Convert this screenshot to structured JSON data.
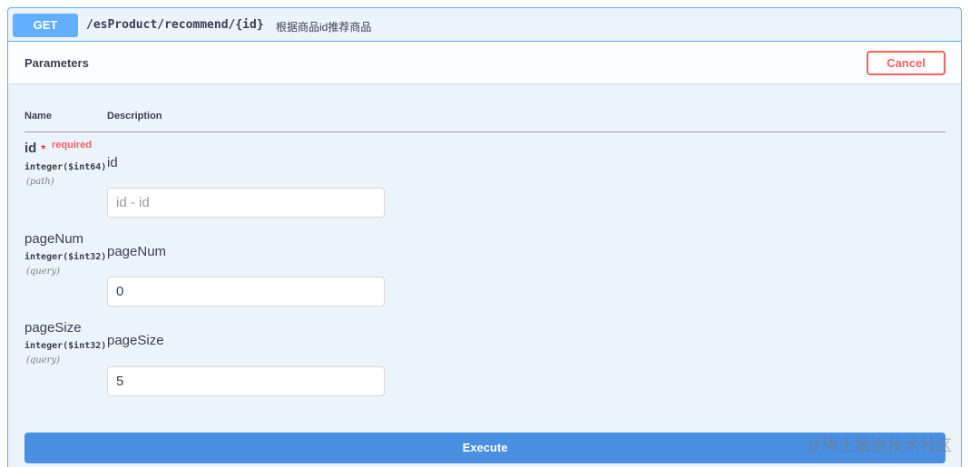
{
  "summary": {
    "method": "GET",
    "path": "/esProduct/recommend/{id}",
    "description": "根据商品id推荐商品"
  },
  "parameters": {
    "title": "Parameters",
    "cancel_label": "Cancel",
    "columns": {
      "name": "Name",
      "description": "Description"
    },
    "items": [
      {
        "name": "id",
        "required_star": "*",
        "required_label": "required",
        "type": "integer($int64)",
        "in": "(path)",
        "description": "id",
        "value": "",
        "placeholder": "id - id"
      },
      {
        "name": "pageNum",
        "type": "integer($int32)",
        "in": "(query)",
        "description": "pageNum",
        "value": "0",
        "placeholder": ""
      },
      {
        "name": "pageSize",
        "type": "integer($int32)",
        "in": "(query)",
        "description": "pageSize",
        "value": "5",
        "placeholder": ""
      }
    ]
  },
  "execute_label": "Execute",
  "watermark": "@稀土掘金技术社区",
  "colors": {
    "get_blue": "#61affe",
    "execute_blue": "#4990e2",
    "cancel_red": "#ff6060",
    "required_red": "#ff6060"
  }
}
